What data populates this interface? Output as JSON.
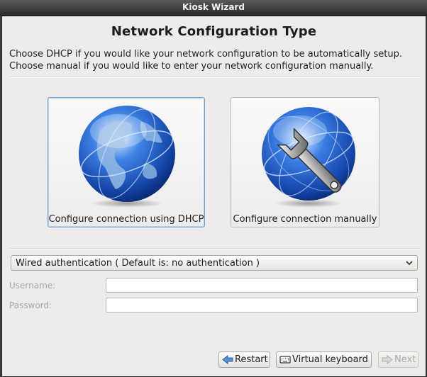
{
  "window": {
    "title": "Kiosk Wizard"
  },
  "page": {
    "heading": "Network Configuration Type",
    "description_line1": "Choose DHCP if you would like your network configuration to be automatically setup.",
    "description_line2": "Choose manual if you would like to enter your network configuration manually."
  },
  "options": {
    "dhcp": {
      "label": "Configure connection using DHCP",
      "icon": "globe-icon",
      "selected": true
    },
    "manual": {
      "label": "Configure connection manually",
      "icon": "globe-wrench-icon",
      "selected": false
    }
  },
  "auth": {
    "selected": "Wired authentication ( Default is: no authentication )",
    "username_label": "Username:",
    "username_value": "",
    "password_label": "Password:",
    "password_value": ""
  },
  "buttons": {
    "restart": "Restart",
    "keyboard": "Virtual keyboard",
    "next": "Next",
    "next_enabled": false
  },
  "colors": {
    "selection_border": "#6ca0d0",
    "globe_blue": "#1f5fcf",
    "land": "#7aa6d4"
  }
}
